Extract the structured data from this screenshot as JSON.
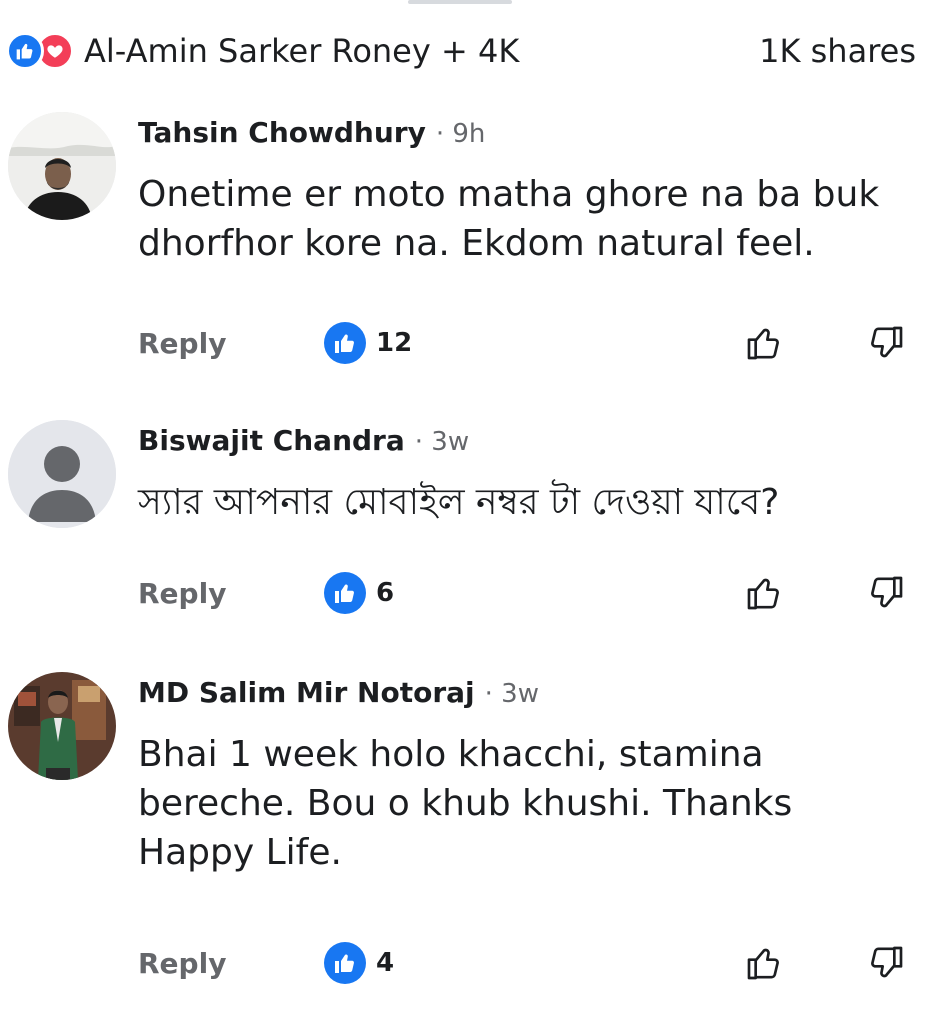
{
  "reactions": {
    "icons": [
      "like-icon",
      "love-icon"
    ],
    "reactors_text": "Al-Amin Sarker Roney + 4K",
    "shares_text": "1K shares"
  },
  "comments": [
    {
      "author": "Tahsin Chowdhury",
      "time": "· 9h",
      "text": "Onetime er moto matha ghore na ba buk\ndhorfhor kore na. Ekdom natural feel.",
      "reply_label": "Reply",
      "like_count": "12",
      "avatar": "photo"
    },
    {
      "author": "Biswajit Chandra",
      "time": "· 3w",
      "text": "স্যার আপনার মোবাইল নম্বর টা দেওয়া যাবে?",
      "reply_label": "Reply",
      "like_count": "6",
      "avatar": "placeholder"
    },
    {
      "author": "MD Salim Mir Notoraj",
      "time": "· 3w",
      "text": "Bhai 1 week holo khacchi, stamina\nbereche. Bou o khub khushi. Thanks\nHappy Life.",
      "reply_label": "Reply",
      "like_count": "4",
      "avatar": "photo"
    }
  ],
  "colors": {
    "like_blue": "#1877f2",
    "love_red": "#f33e58",
    "muted_text": "#65676b",
    "primary_text": "#1c1e21"
  }
}
